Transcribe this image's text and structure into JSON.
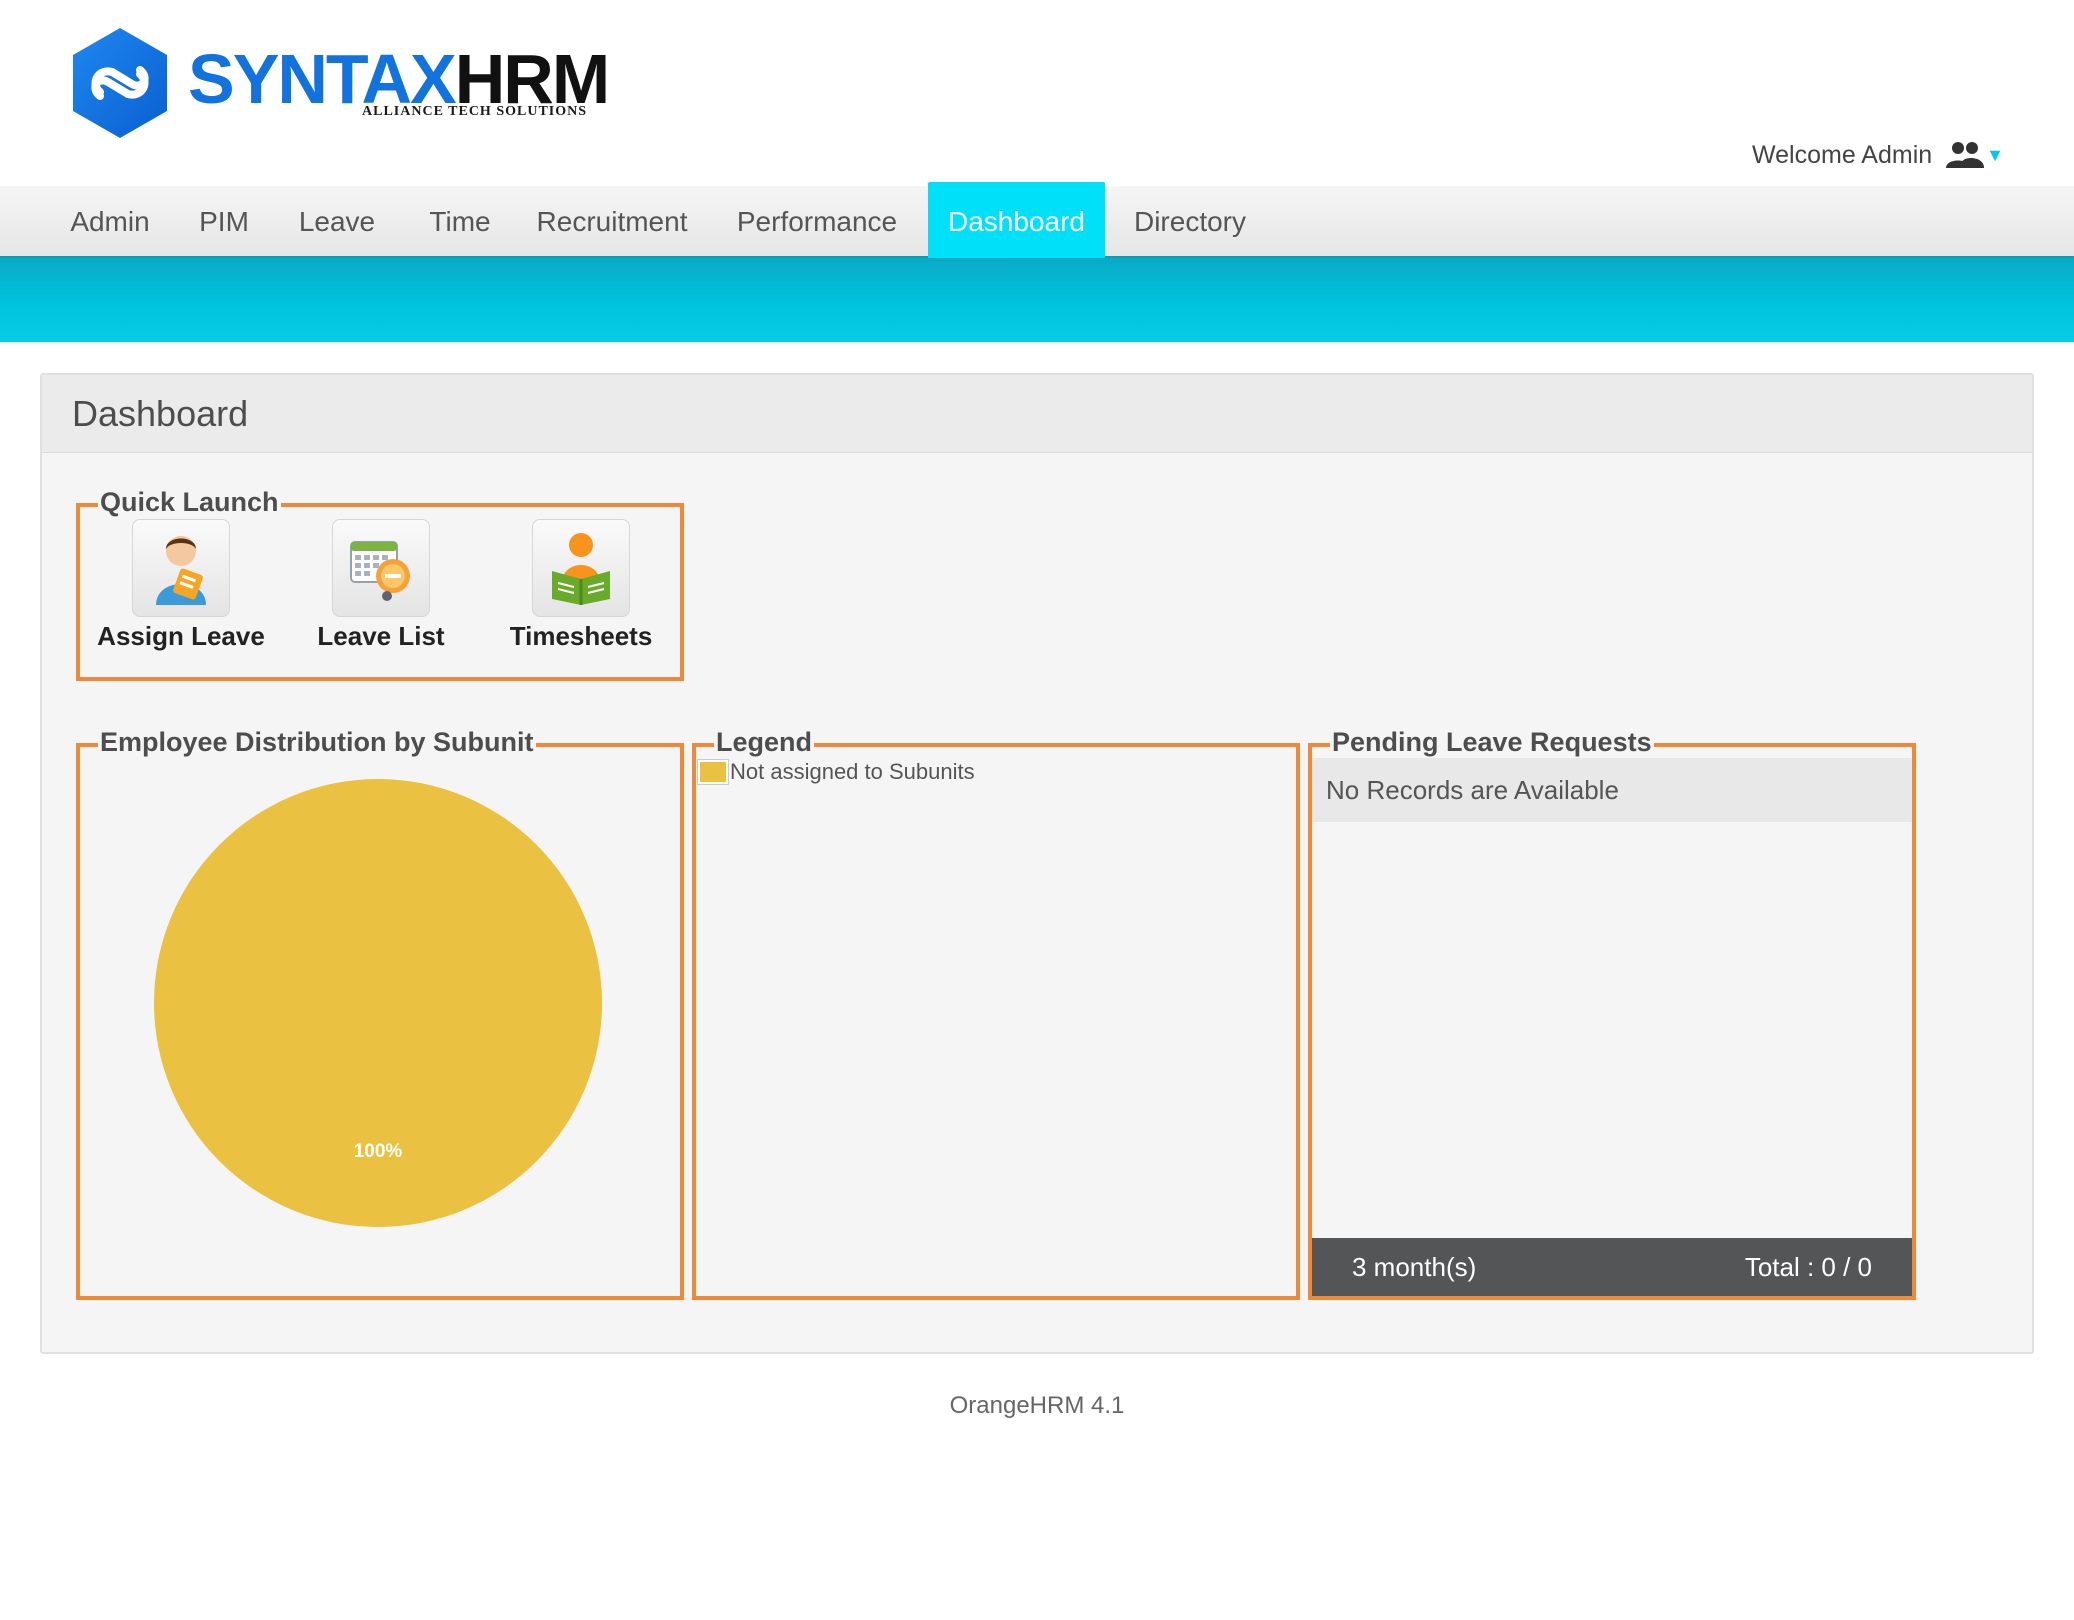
{
  "header": {
    "logo": {
      "word_primary": "SYNTAX",
      "word_secondary": "HRM",
      "tagline": "ALLIANCE TECH SOLUTIONS"
    },
    "welcome_text": "Welcome Admin",
    "user_icon": "users-icon"
  },
  "nav": {
    "items": [
      {
        "label": "Admin"
      },
      {
        "label": "PIM"
      },
      {
        "label": "Leave"
      },
      {
        "label": "Time"
      },
      {
        "label": "Recruitment"
      },
      {
        "label": "Performance"
      },
      {
        "label": "Dashboard",
        "active": true
      },
      {
        "label": "Directory"
      }
    ]
  },
  "dashboard": {
    "title": "Dashboard",
    "quick_launch": {
      "title": "Quick Launch",
      "items": [
        {
          "label": "Assign Leave",
          "icon": "assign-leave-icon"
        },
        {
          "label": "Leave List",
          "icon": "leave-list-icon"
        },
        {
          "label": "Timesheets",
          "icon": "timesheets-icon"
        }
      ]
    },
    "employee_distribution": {
      "title": "Employee Distribution by Subunit"
    },
    "legend": {
      "title": "Legend",
      "items": [
        {
          "label": "Not assigned to Subunits",
          "color": "#ebc142"
        }
      ]
    },
    "pending_leave": {
      "title": "Pending Leave Requests",
      "empty_text": "No Records are Available",
      "period": "3 month(s)",
      "total": "Total : 0 / 0"
    }
  },
  "chart_data": {
    "type": "pie",
    "slices": [
      {
        "label": "Not assigned to Subunits",
        "value": 100,
        "display": "100%",
        "color": "#ebc142"
      }
    ]
  },
  "footer": {
    "text": "OrangeHRM 4.1"
  },
  "colors": {
    "accent": "#00e0f8",
    "banner": "#00c2dc",
    "box_border": "#f0883a",
    "pie": "#ebc142"
  }
}
